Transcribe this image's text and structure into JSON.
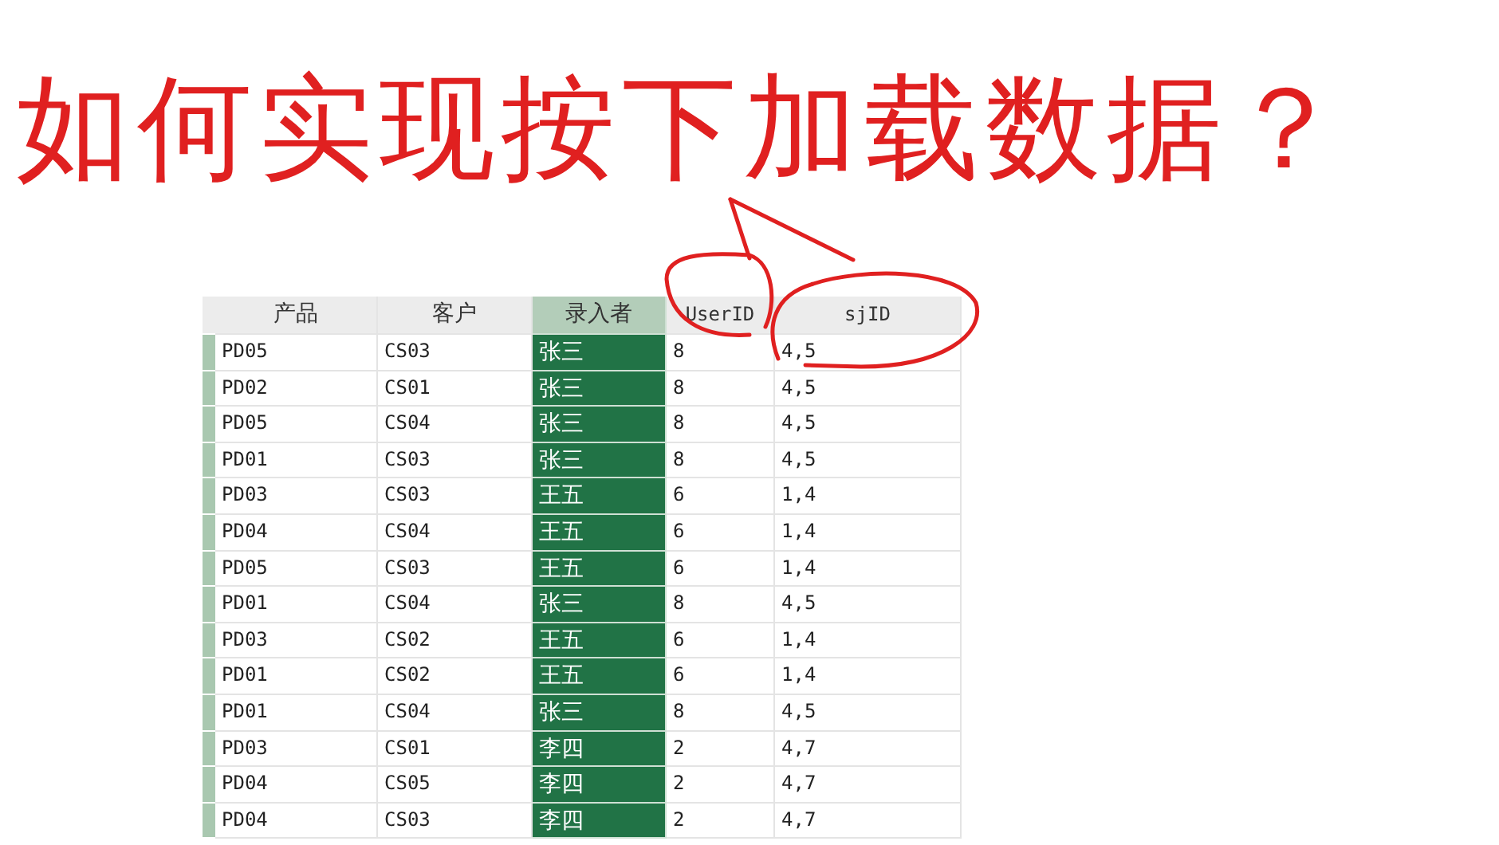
{
  "annotation": {
    "text": "如何实现按下加载数据？"
  },
  "table": {
    "columns": [
      {
        "label": "产品",
        "selected": false
      },
      {
        "label": "客户",
        "selected": false
      },
      {
        "label": "录入者",
        "selected": true
      },
      {
        "label": "UserID",
        "selected": false
      },
      {
        "label": "sjID",
        "selected": false
      }
    ],
    "rows": [
      [
        "PD05",
        "CS03",
        "张三",
        "8",
        "4,5"
      ],
      [
        "PD02",
        "CS01",
        "张三",
        "8",
        "4,5"
      ],
      [
        "PD05",
        "CS04",
        "张三",
        "8",
        "4,5"
      ],
      [
        "PD01",
        "CS03",
        "张三",
        "8",
        "4,5"
      ],
      [
        "PD03",
        "CS03",
        "王五",
        "6",
        "1,4"
      ],
      [
        "PD04",
        "CS04",
        "王五",
        "6",
        "1,4"
      ],
      [
        "PD05",
        "CS03",
        "王五",
        "6",
        "1,4"
      ],
      [
        "PD01",
        "CS04",
        "张三",
        "8",
        "4,5"
      ],
      [
        "PD03",
        "CS02",
        "王五",
        "6",
        "1,4"
      ],
      [
        "PD01",
        "CS02",
        "王五",
        "6",
        "1,4"
      ],
      [
        "PD01",
        "CS04",
        "张三",
        "8",
        "4,5"
      ],
      [
        "PD03",
        "CS01",
        "李四",
        "2",
        "4,7"
      ],
      [
        "PD04",
        "CS05",
        "李四",
        "2",
        "4,7"
      ],
      [
        "PD04",
        "CS03",
        "李四",
        "2",
        "4,7"
      ]
    ]
  }
}
